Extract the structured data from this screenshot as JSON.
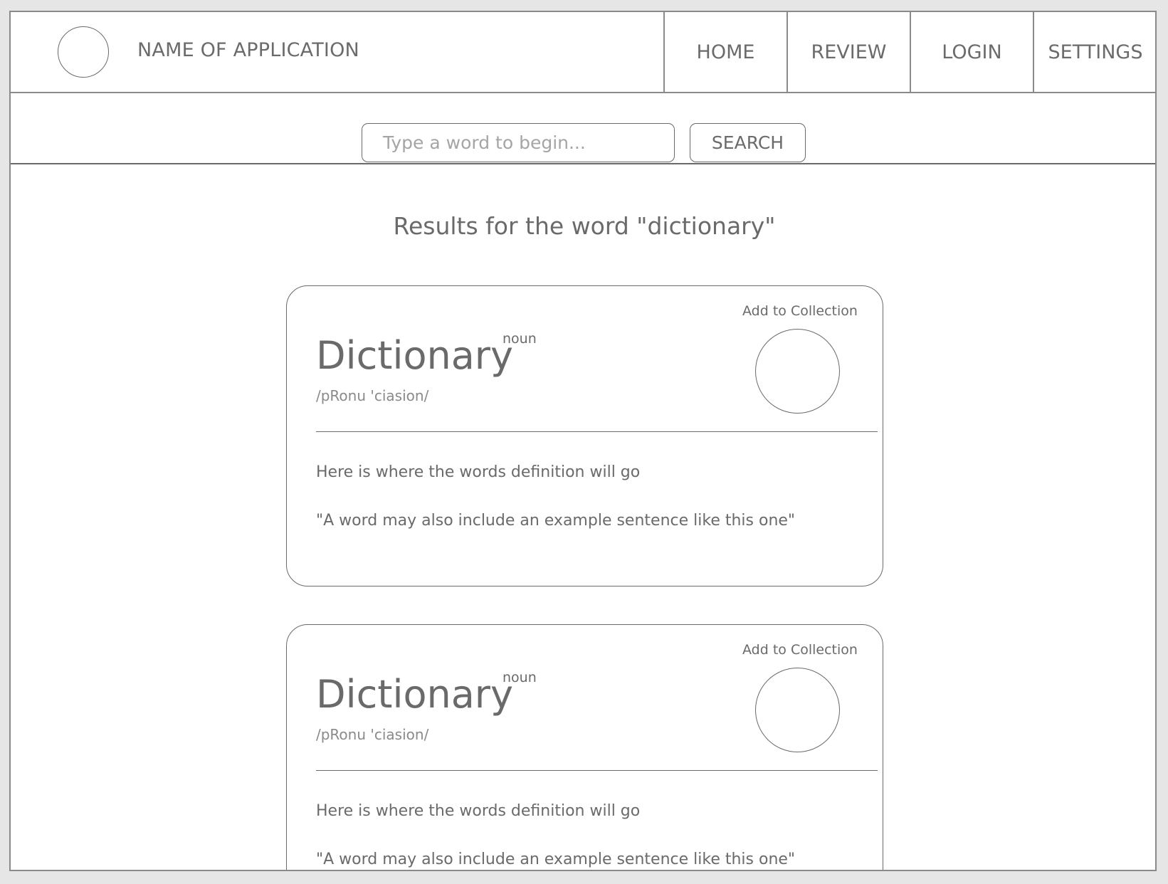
{
  "header": {
    "app_name": "NAME OF APPLICATION",
    "nav": [
      {
        "label": "HOME"
      },
      {
        "label": "REVIEW"
      },
      {
        "label": "LOGIN"
      },
      {
        "label": "SETTINGS"
      }
    ]
  },
  "search": {
    "placeholder": "Type a word to begin...",
    "value": "",
    "button_label": "SEARCH"
  },
  "results": {
    "title": "Results for the word \"dictionary\"",
    "cards": [
      {
        "word": "Dictionary",
        "part_of_speech": "noun",
        "pronunciation": "/pRonu 'ciasion/",
        "add_label": "Add to Collection",
        "definition": "Here is where the words definition will go",
        "example": "\"A word may also include an example sentence like this one\""
      },
      {
        "word": "Dictionary",
        "part_of_speech": "noun",
        "pronunciation": "/pRonu 'ciasion/",
        "add_label": "Add to Collection",
        "definition": "Here is where the words definition will go",
        "example": "\"A word may also include an example sentence like this one\""
      }
    ]
  }
}
